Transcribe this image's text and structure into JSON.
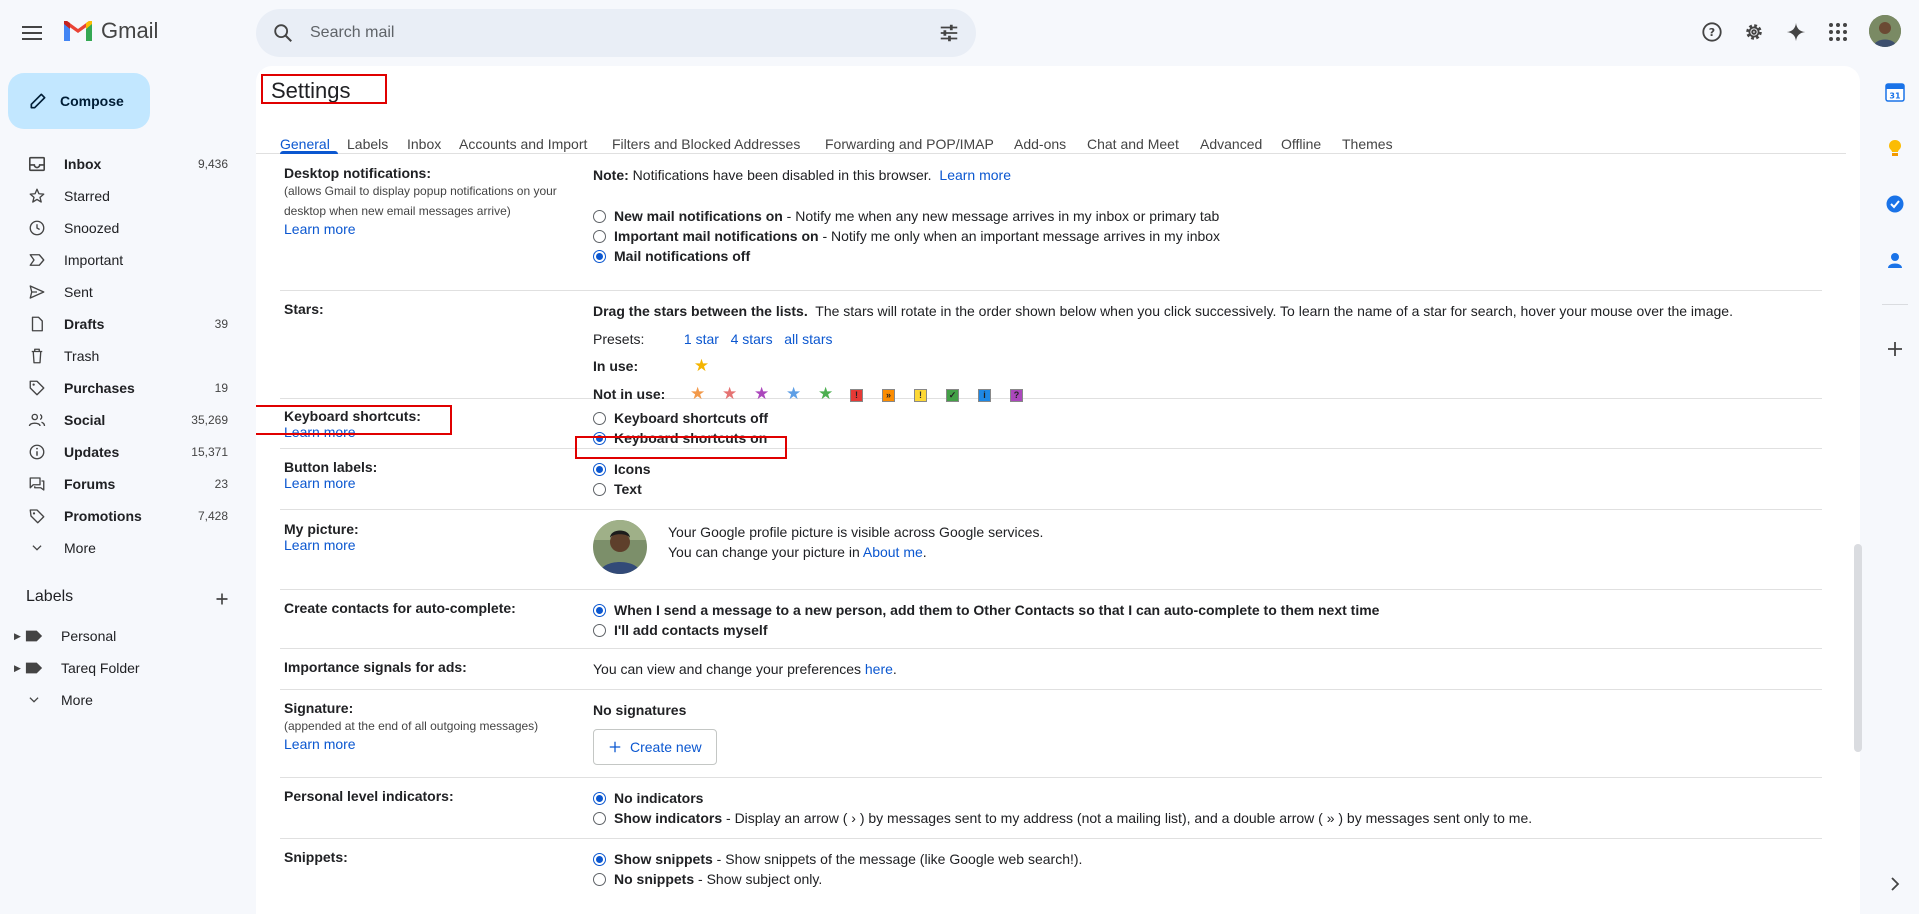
{
  "app": {
    "name": "Gmail"
  },
  "search": {
    "placeholder": "Search mail"
  },
  "compose": {
    "label": "Compose"
  },
  "nav": [
    {
      "icon": "inbox-icon",
      "label": "Inbox",
      "count": "9,436",
      "bold": true
    },
    {
      "icon": "star-icon",
      "label": "Starred",
      "count": "",
      "bold": false
    },
    {
      "icon": "clock-icon",
      "label": "Snoozed",
      "count": "",
      "bold": false
    },
    {
      "icon": "important-icon",
      "label": "Important",
      "count": "",
      "bold": false
    },
    {
      "icon": "send-icon",
      "label": "Sent",
      "count": "",
      "bold": false
    },
    {
      "icon": "draft-icon",
      "label": "Drafts",
      "count": "39",
      "bold": true
    },
    {
      "icon": "trash-icon",
      "label": "Trash",
      "count": "",
      "bold": false
    },
    {
      "icon": "tag-icon",
      "label": "Purchases",
      "count": "19",
      "bold": true
    },
    {
      "icon": "people-icon",
      "label": "Social",
      "count": "35,269",
      "bold": true
    },
    {
      "icon": "info-icon",
      "label": "Updates",
      "count": "15,371",
      "bold": true
    },
    {
      "icon": "forum-icon",
      "label": "Forums",
      "count": "23",
      "bold": true
    },
    {
      "icon": "label-icon",
      "label": "Promotions",
      "count": "7,428",
      "bold": true
    },
    {
      "icon": "chevron-down-icon",
      "label": "More",
      "count": "",
      "bold": false
    }
  ],
  "labels": {
    "heading": "Labels",
    "items": [
      {
        "label": "Personal"
      },
      {
        "label": "Tareq Folder"
      },
      {
        "label": "More"
      }
    ]
  },
  "settings": {
    "title": "Settings",
    "tabs": [
      "General",
      "Labels",
      "Inbox",
      "Accounts and Import",
      "Filters and Blocked Addresses",
      "Forwarding and POP/IMAP",
      "Add-ons",
      "Chat and Meet",
      "Advanced",
      "Offline",
      "Themes"
    ],
    "active_tab": "General",
    "desktop_notifications": {
      "label": "Desktop notifications:",
      "sub1": "(allows Gmail to display popup notifications on your",
      "sub2": "desktop when new email messages arrive)",
      "learn_more": "Learn more",
      "note_bold": "Note:",
      "note_text": "Notifications have been disabled in this browser.",
      "note_link": "Learn more",
      "options": [
        {
          "bold": "New mail notifications on",
          "text": " - Notify me when any new message arrives in my inbox or primary tab",
          "selected": false
        },
        {
          "bold": "Important mail notifications on",
          "text": " - Notify me only when an important message arrives in my inbox",
          "selected": false
        },
        {
          "bold": "Mail notifications off",
          "text": "",
          "selected": true
        }
      ]
    },
    "stars": {
      "label": "Stars:",
      "desc_bold": "Drag the stars between the lists.",
      "desc": "The stars will rotate in the order shown below when you click successively. To learn the name of a star for search, hover your mouse over the image.",
      "presets_label": "Presets:",
      "presets": [
        "1 star",
        "4 stars",
        "all stars"
      ],
      "in_use_label": "In use:",
      "not_in_use_label": "Not in use:",
      "in_use": [
        {
          "icon": "yellow-star-icon",
          "color": "#f4b400"
        }
      ],
      "not_in_use": [
        {
          "icon": "orange-star-icon",
          "color": "#f2994a",
          "glyph": "★"
        },
        {
          "icon": "red-star-icon",
          "color": "#e57373",
          "glyph": "★"
        },
        {
          "icon": "purple-star-icon",
          "color": "#ab47bc",
          "glyph": "★"
        },
        {
          "icon": "blue-star-icon",
          "color": "#5c9ee6",
          "glyph": "★"
        },
        {
          "icon": "green-star-icon",
          "color": "#4caf50",
          "glyph": "★"
        },
        {
          "icon": "red-bang-icon",
          "color": "#e53935",
          "glyph": "!"
        },
        {
          "icon": "orange-guillemet-icon",
          "color": "#fb8c00",
          "glyph": "»"
        },
        {
          "icon": "yellow-bang-icon",
          "color": "#fdd835",
          "glyph": "!"
        },
        {
          "icon": "green-check-icon",
          "color": "#43a047",
          "glyph": "✓"
        },
        {
          "icon": "blue-info-icon",
          "color": "#1e88e5",
          "glyph": "i"
        },
        {
          "icon": "purple-question-icon",
          "color": "#ab47bc",
          "glyph": "?"
        }
      ]
    },
    "keyboard_shortcuts": {
      "label": "Keyboard shortcuts:",
      "learn_more": "Learn more",
      "off": "Keyboard shortcuts off",
      "on": "Keyboard shortcuts on",
      "selected": "on"
    },
    "button_labels": {
      "label": "Button labels:",
      "learn_more": "Learn more",
      "icons": "Icons",
      "text": "Text"
    },
    "my_picture": {
      "label": "My picture:",
      "learn_more": "Learn more",
      "line1": "Your Google profile picture is visible across Google services.",
      "line2": "You can change your picture in",
      "link": "About me",
      "period": "."
    },
    "contacts": {
      "label": "Create contacts for auto-complete:",
      "opt1": "When I send a message to a new person, add them to Other Contacts so that I can auto-complete to them next time",
      "opt2": "I'll add contacts myself"
    },
    "importance": {
      "label": "Importance signals for ads:",
      "text": "You can view and change your preferences",
      "link": "here",
      "period": "."
    },
    "signature": {
      "label": "Signature:",
      "sub": "(appended at the end of all outgoing messages)",
      "learn_more": "Learn more",
      "none": "No signatures",
      "create": "Create new"
    },
    "personal_indicators": {
      "label": "Personal level indicators:",
      "opt1": "No indicators",
      "opt2_bold": "Show indicators",
      "opt2_text": " - Display an arrow ( › ) by messages sent to my address (not a mailing list), and a double arrow ( » ) by messages sent only to me."
    },
    "snippets": {
      "label": "Snippets:",
      "opt1_bold": "Show snippets",
      "opt1_text": " - Show snippets of the message (like Google web search!).",
      "opt2_bold": "No snippets",
      "opt2_text": " - Show subject only."
    }
  },
  "side_panel": {
    "calendar_day": "31"
  }
}
